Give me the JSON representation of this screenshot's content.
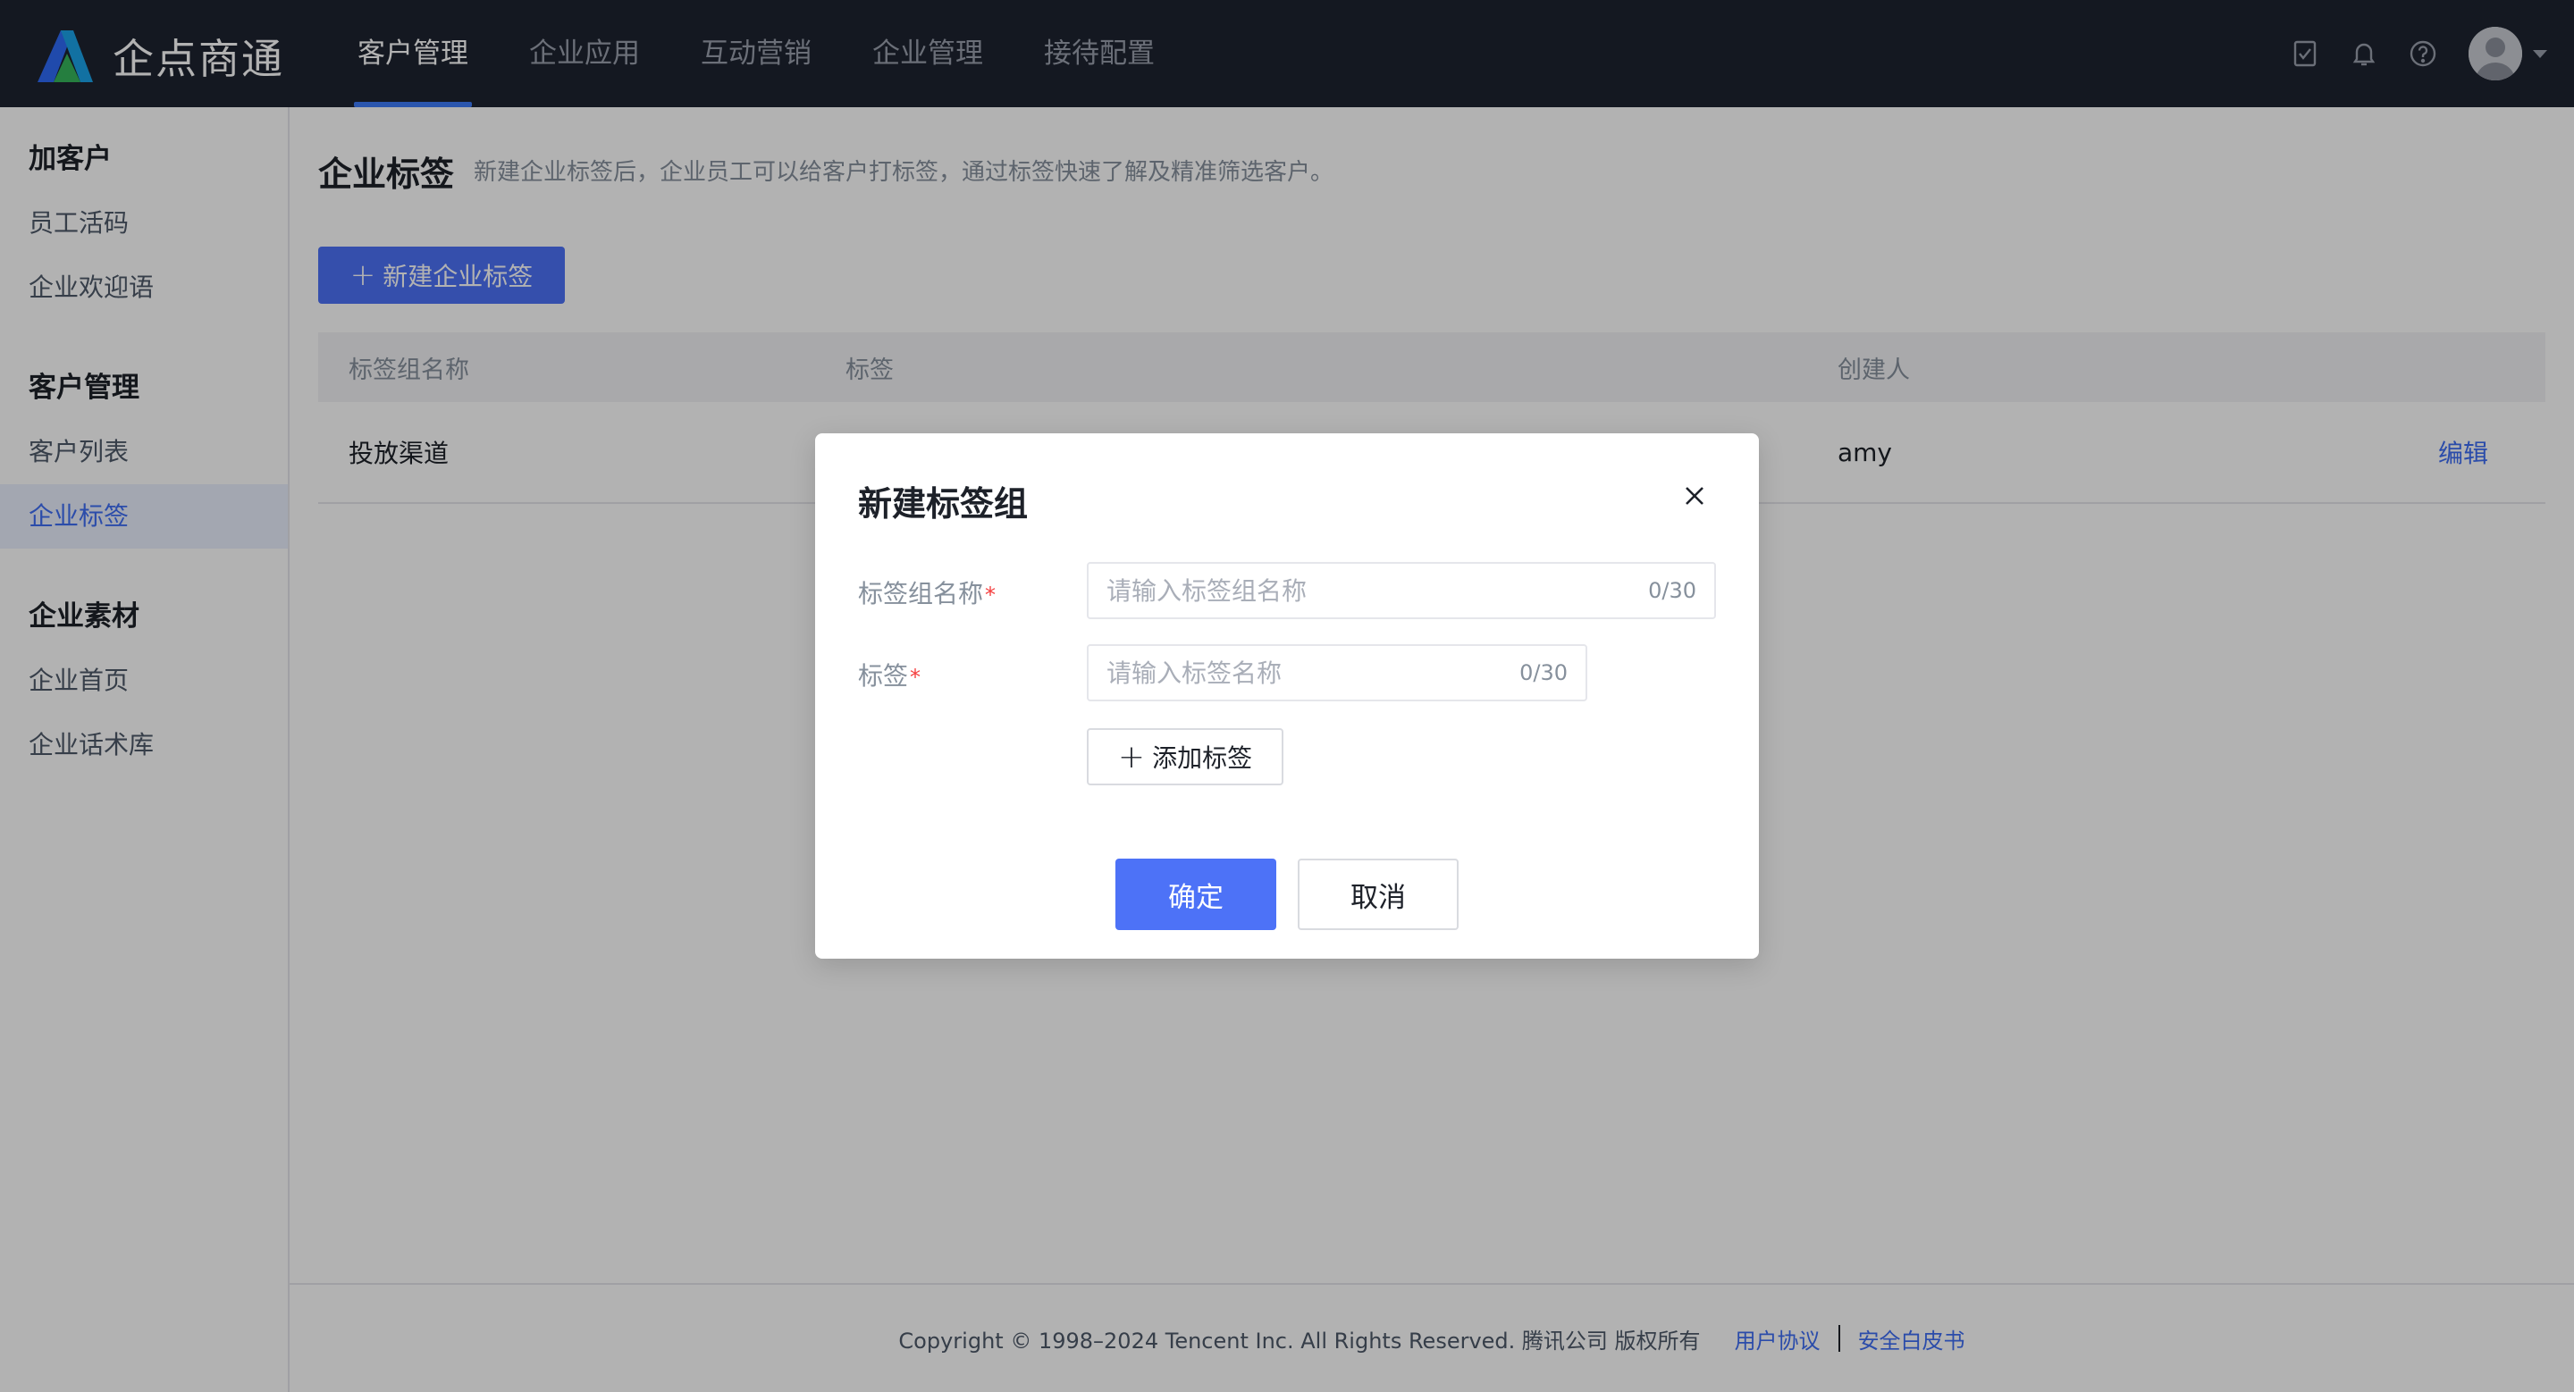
{
  "brand": {
    "name": "企点商通"
  },
  "nav": {
    "items": [
      {
        "label": "客户管理",
        "active": true
      },
      {
        "label": "企业应用"
      },
      {
        "label": "互动营销"
      },
      {
        "label": "企业管理"
      },
      {
        "label": "接待配置"
      }
    ],
    "icons": [
      "task-check-icon",
      "bell-icon",
      "help-icon",
      "avatar",
      "caret-down-icon"
    ]
  },
  "sidebar": {
    "groups": [
      {
        "title": "加客户",
        "items": [
          {
            "label": "员工活码"
          },
          {
            "label": "企业欢迎语"
          }
        ]
      },
      {
        "title": "客户管理",
        "items": [
          {
            "label": "客户列表"
          },
          {
            "label": "企业标签",
            "active": true
          }
        ]
      },
      {
        "title": "企业素材",
        "items": [
          {
            "label": "企业首页"
          },
          {
            "label": "企业话术库"
          }
        ]
      }
    ]
  },
  "page": {
    "title": "企业标签",
    "description": "新建企业标签后，企业员工可以给客户打标签，通过标签快速了解及精准筛选客户。",
    "new_button": "新建企业标签"
  },
  "table": {
    "columns": [
      "标签组名称",
      "标签",
      "创建人",
      ""
    ],
    "rows": [
      {
        "group": "投放渠道",
        "tags": "",
        "creator": "amy",
        "action": "编辑"
      }
    ]
  },
  "footer": {
    "copyright": "Copyright © 1998–2024 Tencent Inc. All Rights Reserved. 腾讯公司 版权所有",
    "link1": "用户协议",
    "link2": "安全白皮书"
  },
  "dialog": {
    "title": "新建标签组",
    "group_name_label": "标签组名称",
    "group_name_placeholder": "请输入标签组名称",
    "group_name_counter": "0/30",
    "tag_label": "标签",
    "tag_placeholder": "请输入标签名称",
    "tag_counter": "0/30",
    "required_mark": "*",
    "add_tag_button": "添加标签",
    "confirm_button": "确定",
    "cancel_button": "取消"
  },
  "colors": {
    "topbar": "#1e2330",
    "accent": "#4d72f7",
    "link": "#3e6df4",
    "required": "#f53f3f"
  }
}
